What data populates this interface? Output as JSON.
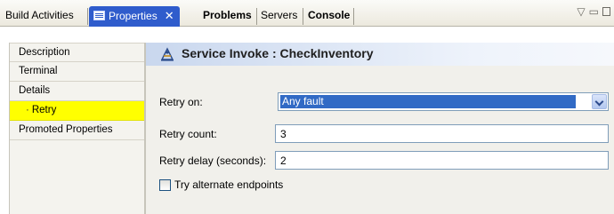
{
  "tabs": [
    {
      "label": "Build Activities"
    },
    {
      "label": "Properties",
      "close": "✕"
    },
    {
      "label": "Problems"
    },
    {
      "label": "Servers"
    },
    {
      "label": "Console"
    }
  ],
  "nav": {
    "items": [
      {
        "label": "Description"
      },
      {
        "label": "Terminal"
      },
      {
        "label": "Details"
      },
      {
        "label": "Retry",
        "bullet": "·"
      },
      {
        "label": "Promoted Properties"
      }
    ]
  },
  "header": {
    "title": "Service Invoke : CheckInventory",
    "icon": "service-invoke-icon"
  },
  "form": {
    "retry_on_label": "Retry on:",
    "retry_on_value": "Any fault",
    "retry_count_label": "Retry count:",
    "retry_count_value": "3",
    "retry_delay_label": "Retry delay (seconds):",
    "retry_delay_value": "2",
    "alternate_label": "Try alternate endpoints"
  },
  "colors": {
    "active_tab": "#2f5ccc",
    "selected_nav": "#ffff00",
    "selected_value": "#316ac5"
  }
}
